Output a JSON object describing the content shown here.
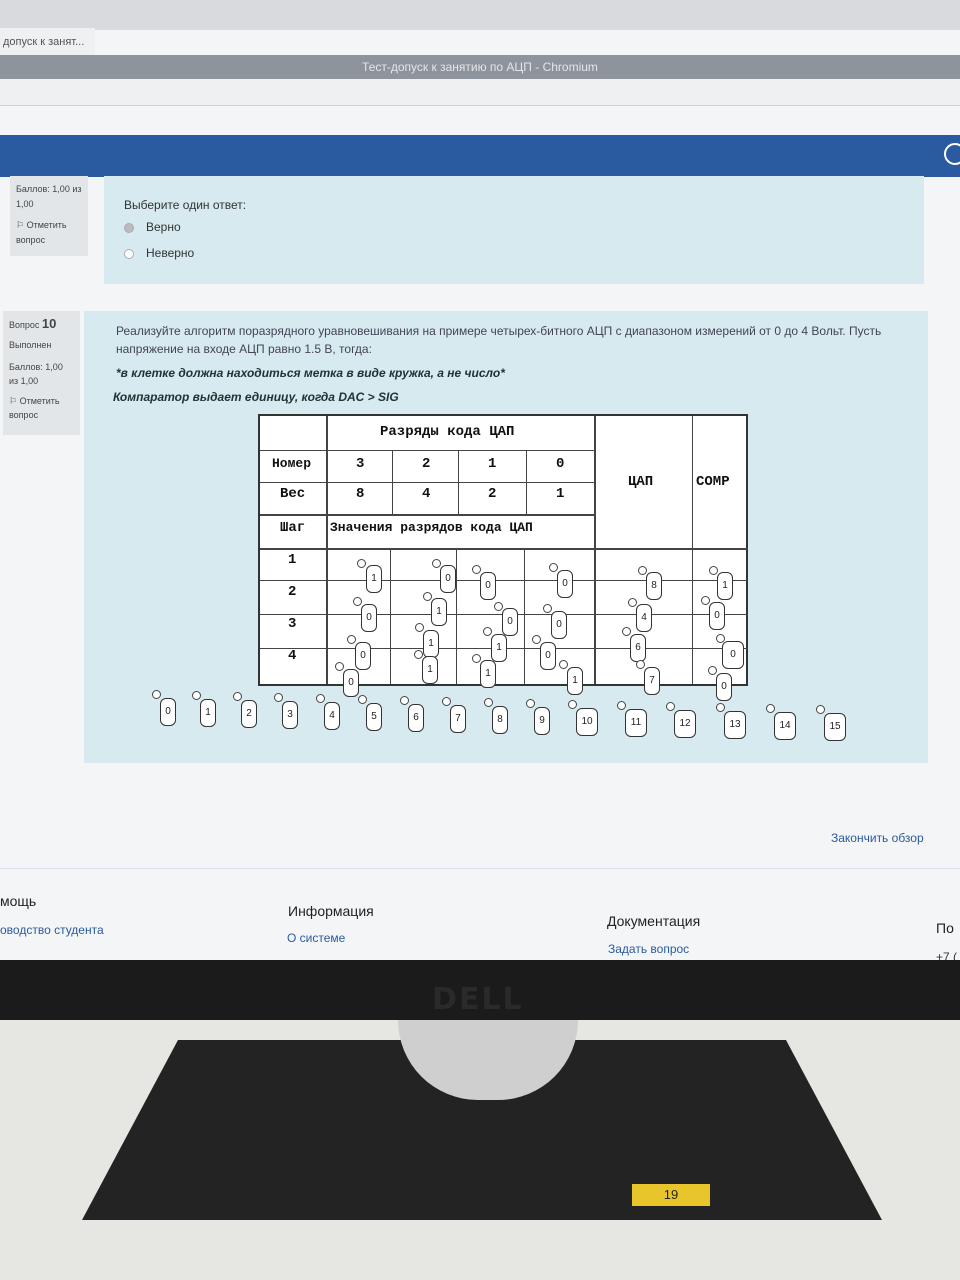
{
  "browser": {
    "tab_title": "допуск к занят...",
    "window_title": "Тест-допуск к занятию по АЦП - Chromium"
  },
  "prev_question": {
    "score": "Баллов: 1,00 из 1,00",
    "flag_label": "Отметить вопрос",
    "prompt": "Выберите один ответ:",
    "options": [
      {
        "label": "Верно",
        "selected": true
      },
      {
        "label": "Неверно",
        "selected": false
      }
    ]
  },
  "question": {
    "label_prefix": "Вопрос",
    "number": "10",
    "status": "Выполнен",
    "score": "Баллов: 1,00 из 1,00",
    "flag_label": "Отметить вопрос",
    "text": "Реализуйте алгоритм поразрядного уравновешивания на примере четырех-битного АЦП с диапазоном измерений от 0 до 4 Вольт. Пусть напряжение на входе АЦП равно 1.5 В, тогда:",
    "note1": "*в клетке должна находиться метка в виде кружка, а не число*",
    "note2": "Компаратор выдает единицу, когда DAC > SIG"
  },
  "table": {
    "header_bits": "Разряды кода ЦАП",
    "row_number_label": "Номер",
    "bit_numbers": [
      "3",
      "2",
      "1",
      "0"
    ],
    "row_weight_label": "Вес",
    "weights": [
      "8",
      "4",
      "2",
      "1"
    ],
    "step_label": "Шаг",
    "values_label": "Значения разрядов кода ЦАП",
    "dac_label": "ЦАП",
    "comp_label": "COMP",
    "steps": [
      "1",
      "2",
      "3",
      "4"
    ]
  },
  "placed_chips": [
    "1",
    "0",
    "0",
    "0",
    "8",
    "1",
    "0",
    "1",
    "0",
    "0",
    "4",
    "0",
    "0",
    "1",
    "1",
    "0",
    "6",
    "0",
    "1",
    "1",
    "0",
    "7",
    "1",
    "0",
    "1",
    "1"
  ],
  "palette": [
    "0",
    "1",
    "2",
    "3",
    "4",
    "5",
    "6",
    "7",
    "8",
    "9",
    "10",
    "11",
    "12",
    "13",
    "14",
    "15"
  ],
  "finish_review": "Закончить обзор",
  "footer": {
    "help_heading": "мощь",
    "help_link": "оводство студента",
    "info_heading": "Информация",
    "info_link": "О системе",
    "docs_heading": "Документация",
    "docs_link": "Задать вопрос",
    "contact_heading": "По",
    "contact_value": "+7 ("
  },
  "monitor": {
    "brand": "DELL",
    "sticker": "19"
  }
}
